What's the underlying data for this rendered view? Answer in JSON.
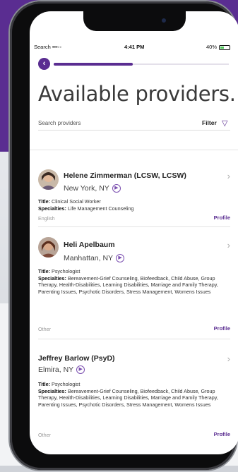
{
  "status_bar": {
    "carrier": "Search •••◦◦",
    "time": "4:41 PM",
    "battery": "40%",
    "battery_level": 0.4
  },
  "header": {
    "title": "Available providers.",
    "progress": 0.45
  },
  "search": {
    "placeholder": "Search providers",
    "filter_label": "Filter"
  },
  "providers": [
    {
      "name": "Helene Zimmerman (LCSW, LCSW)",
      "location": "New York, NY",
      "title_label": "Title:",
      "title": "Clinical Social Worker",
      "specialties_label": "Specialties:",
      "specialties": "Life Management Counseling",
      "language": "English",
      "profile_label": "Profile"
    },
    {
      "name": "Heli Apelbaum",
      "location": "Manhattan, NY",
      "title_label": "Title:",
      "title": "Psychologist",
      "specialties_label": "Specialties:",
      "specialties": "Bereavement-Grief Counseling, Biofeedback, Child Abuse, Group Therapy, Health-Disabilities, Learning Disabilities, Marriage and Family Therapy, Parenting Issues, Psychotic Disorders, Stress Management, Womens Issues",
      "language": "Other",
      "profile_label": "Profile"
    },
    {
      "name": "Jeffrey  Barlow (PsyD)",
      "location": "Elmira, NY",
      "title_label": "Title:",
      "title": "Psychologist",
      "specialties_label": "Specialties:",
      "specialties": "Bereavement-Grief Counseling, Biofeedback, Child Abuse, Group Therapy, Health-Disabilities, Learning Disabilities, Marriage and Family Therapy, Parenting Issues, Psychotic Disorders, Stress Management, Womens Issues",
      "language": "Other",
      "profile_label": "Profile"
    }
  ],
  "colors": {
    "accent": "#5a2d91",
    "background_band": "#5a2d91"
  },
  "icons": {
    "back": "chevron-left-icon",
    "filter": "funnel-icon",
    "location": "arrow-circle-icon",
    "row": "chevron-right-icon"
  }
}
